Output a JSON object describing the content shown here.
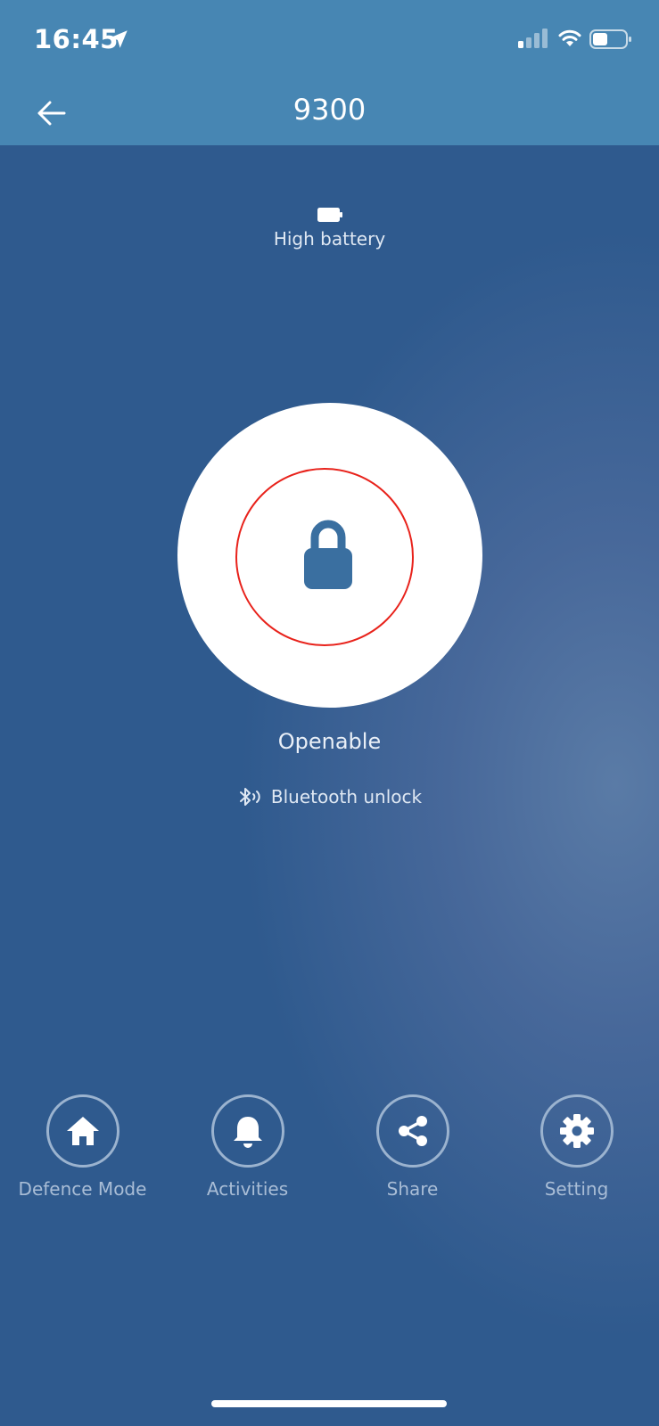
{
  "status_bar": {
    "time": "16:45",
    "location_icon": "location-arrow-icon",
    "signal_icon": "cellular-signal-icon",
    "wifi_icon": "wifi-icon",
    "battery_icon": "battery-icon"
  },
  "nav": {
    "back_icon": "back-arrow-icon",
    "title": "9300"
  },
  "battery": {
    "icon": "battery-full-icon",
    "label": "High battery"
  },
  "lock": {
    "icon": "padlock-icon",
    "ring_color": "#e8221b",
    "icon_color": "#3a6fa0",
    "state": "Openable",
    "method_icon": "bluetooth-icon",
    "method": "Bluetooth unlock"
  },
  "actions": [
    {
      "label": "Defence Mode",
      "icon": "home-icon"
    },
    {
      "label": "Activities",
      "icon": "bell-icon"
    },
    {
      "label": "Share",
      "icon": "share-icon"
    },
    {
      "label": "Setting",
      "icon": "gear-icon"
    }
  ],
  "colors": {
    "header": "#4786b3",
    "background": "#2f5a8e"
  }
}
